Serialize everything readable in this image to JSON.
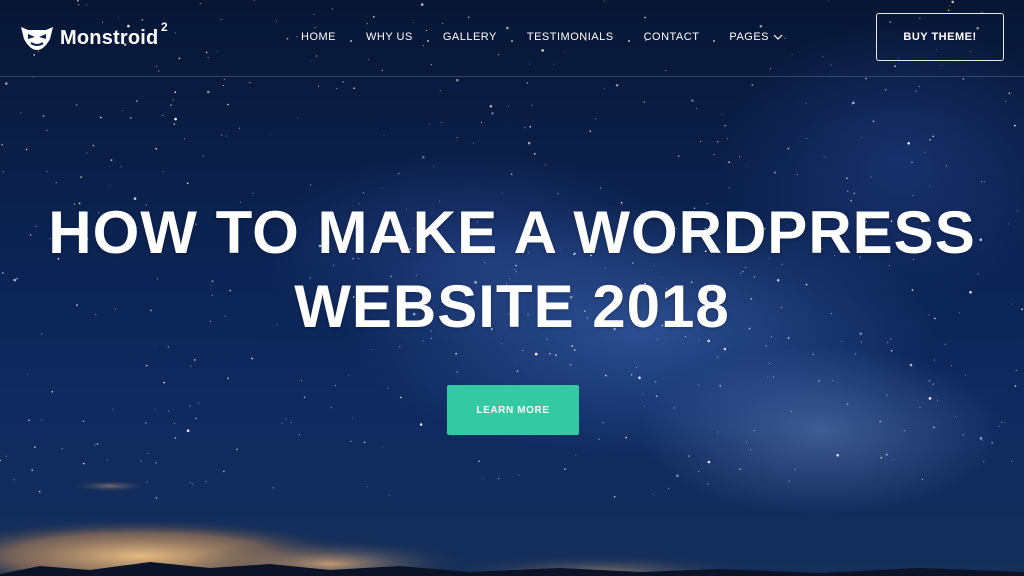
{
  "brand": {
    "name": "Monstroid",
    "superscript": "2",
    "icon": "monster-mask-icon"
  },
  "nav": {
    "items": [
      {
        "label": "HOME"
      },
      {
        "label": "WHY US"
      },
      {
        "label": "GALLERY"
      },
      {
        "label": "TESTIMONIALS"
      },
      {
        "label": "CONTACT"
      },
      {
        "label": "PAGES",
        "icon": "chevron-down-icon"
      }
    ]
  },
  "header": {
    "buy_label": "BUY THEME!"
  },
  "hero": {
    "title_line1": "HOW TO MAKE A WORDPRESS",
    "title_line2": "WEBSITE 2018",
    "cta_label": "LEARN MORE"
  },
  "colors": {
    "accent": "#33c9a1",
    "sky_dark": "#081634",
    "sky_mid": "#0e2a60",
    "cloud_glow": "#e8b87a"
  }
}
